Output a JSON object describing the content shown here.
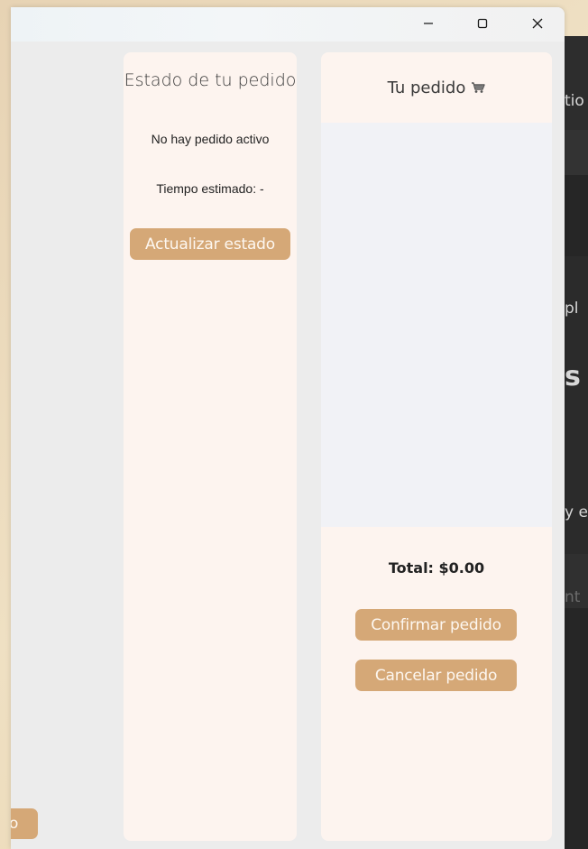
{
  "window": {
    "controls": {
      "minimize_icon": "minimize-icon",
      "maximize_icon": "maximize-icon",
      "close_icon": "close-icon"
    }
  },
  "background_app": {
    "fragments": [
      "tio",
      "pl",
      "s i",
      "y e",
      "nt"
    ]
  },
  "status_panel": {
    "title": "Estado de tu pedido",
    "status_text": "No hay pedido activo",
    "estimated_time": "Tiempo estimado: -",
    "refresh_button": "Actualizar estado"
  },
  "order_panel": {
    "title": "Tu pedido",
    "cart_icon": "shopping-cart-icon",
    "items": [],
    "total": "Total: $0.00",
    "confirm_button": "Confirmar pedido",
    "cancel_button": "Cancelar pedido"
  },
  "partial_button": {
    "label": "o"
  },
  "colors": {
    "accent": "#d5a877",
    "panel_bg": "#fdf4ef",
    "list_bg": "#f1f2f6",
    "window_bg": "#ececec",
    "desktop_bg": "#e9d6b6"
  }
}
